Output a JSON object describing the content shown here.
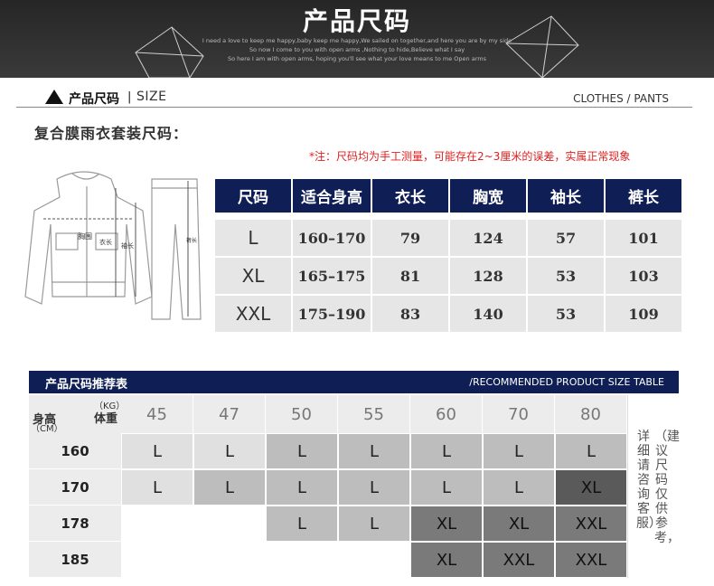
{
  "banner": {
    "title": "产品尺码",
    "lines": [
      "I need a love to keep me happy,baby keep me happy,We sailed on together,and here you are by my side",
      "So now I come to you with open arms ,Nothing to hide,Believe what I say",
      "So here I am with open arms, hoping you'll see what your love means to me Open arms"
    ]
  },
  "section": {
    "title": "产品尺码",
    "separator": "|",
    "size_label": "SIZE",
    "right_label": "CLOTHES / PANTS"
  },
  "subtitle": "复合膜雨衣套装尺码：",
  "note": "*注：尺码均为手工测量，可能存在2~3厘米的误差，实属正常现象",
  "garment_labels": {
    "chest": "胸围",
    "coat_length": "衣长",
    "sleeve": "袖长",
    "pants_length": "裤长"
  },
  "size_table": {
    "headers": [
      "尺码",
      "适合身高",
      "衣长",
      "胸宽",
      "袖长",
      "裤长"
    ],
    "rows": [
      [
        "L",
        "160–170",
        "79",
        "124",
        "57",
        "101"
      ],
      [
        "XL",
        "165–175",
        "81",
        "128",
        "53",
        "103"
      ],
      [
        "XXL",
        "175–190",
        "83",
        "140",
        "53",
        "109"
      ]
    ]
  },
  "recommend": {
    "title": "产品尺码推荐表",
    "subtitle": "/RECOMMENDED PRODUCT SIZE TABLE",
    "weight_unit": "（KG）",
    "weight_label": "体重",
    "height_label": "身高",
    "height_unit": "（CM）",
    "weights": [
      "45",
      "47",
      "50",
      "55",
      "60",
      "70",
      "80"
    ],
    "rows": [
      {
        "height": "160",
        "cells": [
          "L",
          "L",
          "L",
          "L",
          "L",
          "L",
          "L"
        ]
      },
      {
        "height": "170",
        "cells": [
          "L",
          "L",
          "L",
          "L",
          "L",
          "L",
          "XL"
        ]
      },
      {
        "height": "178",
        "cells": [
          "",
          "",
          "L",
          "L",
          "XL",
          "XL",
          "XXL"
        ]
      },
      {
        "height": "185",
        "cells": [
          "",
          "",
          "",
          "",
          "XL",
          "XXL",
          "XXL"
        ]
      }
    ],
    "shades": [
      [
        1,
        1,
        2,
        2,
        2,
        2,
        2
      ],
      [
        1,
        2,
        2,
        2,
        2,
        2,
        5
      ],
      [
        0,
        0,
        2,
        2,
        4,
        4,
        4
      ],
      [
        0,
        0,
        0,
        0,
        4,
        4,
        4
      ]
    ],
    "advice_cols": [
      "（建议尺码仅供参考，",
      "详细请咨询客服）"
    ]
  },
  "colors": {
    "navy": "#0f1f56",
    "note_red": "#e02020"
  }
}
